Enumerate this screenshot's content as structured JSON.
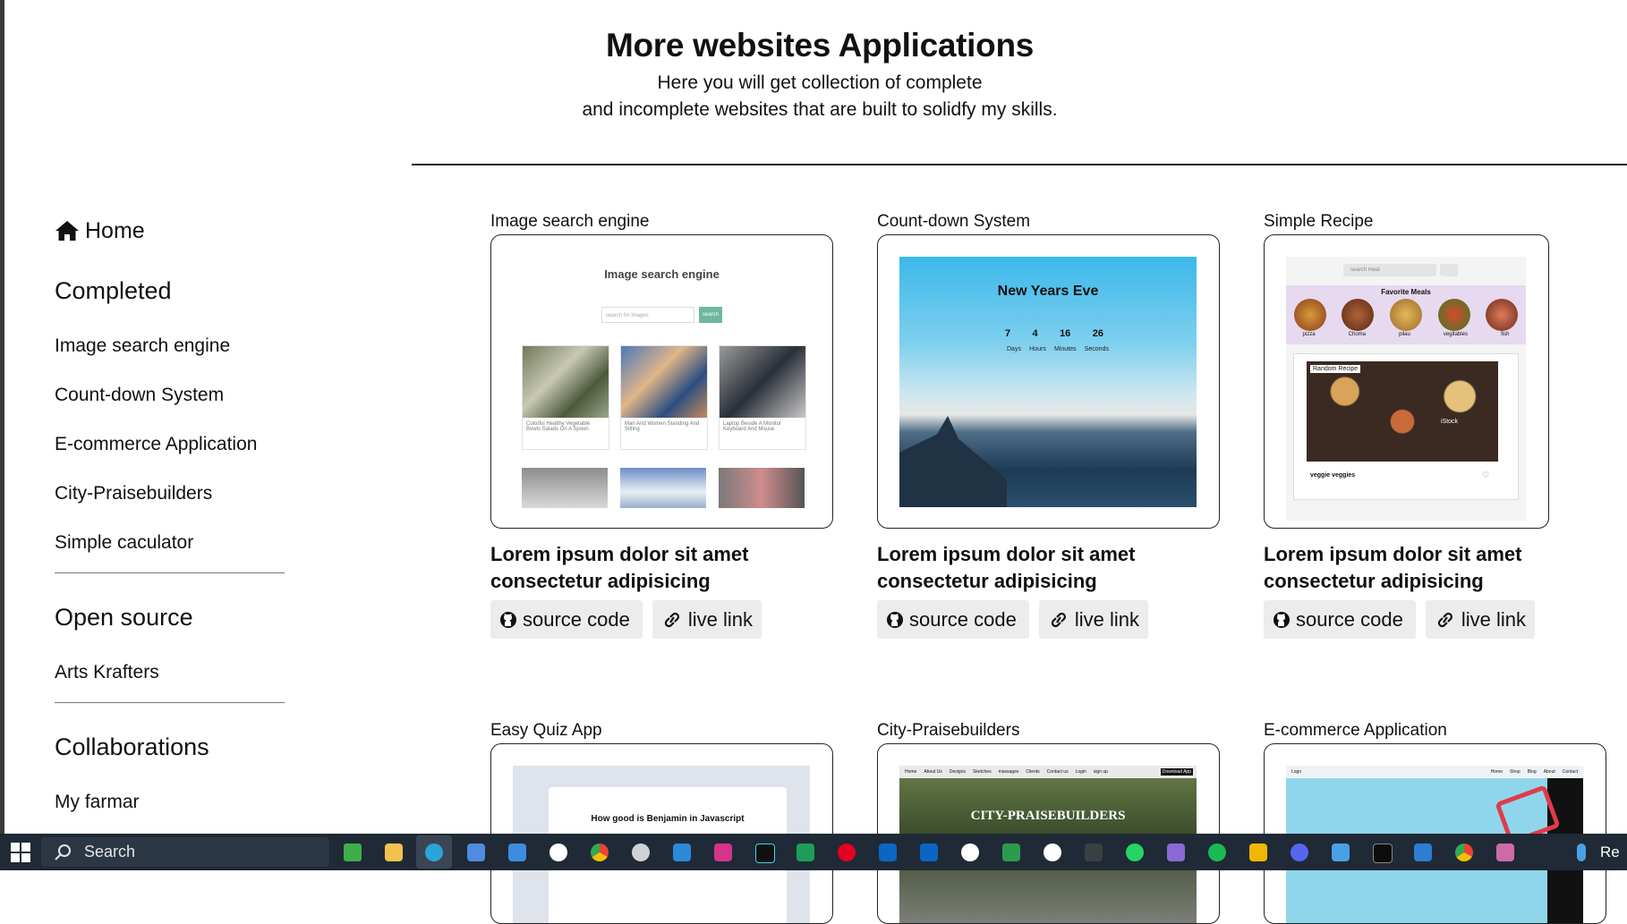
{
  "header": {
    "title": "More websites Applications",
    "line1": "Here you will get collection of complete",
    "line2": "and incomplete websites that are built to solidfy my skills."
  },
  "sidebar": {
    "home": "Home",
    "completed": "Completed",
    "completed_items": [
      "Image search engine",
      "Count-down System",
      "E-commerce Application",
      "City-Praisebuilders",
      "Simple caculator"
    ],
    "open_source": "Open source",
    "open_source_items": [
      "Arts Krafters"
    ],
    "collaborations": "Collaborations",
    "collab_items": [
      "My farmar"
    ]
  },
  "cards": [
    {
      "title": "Image search engine",
      "desc1": "Lorem ipsum dolor sit amet",
      "desc2": "consectetur adipisicing",
      "source": "source code",
      "live": "live link"
    },
    {
      "title": "Count-down System",
      "desc1": "Lorem ipsum dolor sit amet",
      "desc2": "consectetur adipisicing",
      "source": "source code",
      "live": "live link"
    },
    {
      "title": "Simple Recipe",
      "desc1": "Lorem ipsum dolor sit amet",
      "desc2": "consectetur adipisicing",
      "source": "source code",
      "live": "live link"
    },
    {
      "title": "Easy Quiz App"
    },
    {
      "title": "City-Praisebuilders"
    },
    {
      "title": "E-commerce Application"
    }
  ],
  "thumbs": {
    "image_search": {
      "heading": "Image search engine",
      "placeholder": "search for images",
      "button": "search",
      "captions": [
        "Colorful Healthy Vegetable Bowls Salads On A Spoon",
        "Man And Women Standing And Sitting",
        "Laptop Beside A Monitor Keyboard And Mouse"
      ]
    },
    "countdown": {
      "heading": "New Years Eve",
      "numbers": [
        "7",
        "4",
        "16",
        "26"
      ],
      "units": [
        "Days",
        "Hours",
        "Minutes",
        "Seconds"
      ]
    },
    "recipe": {
      "search": "search meal",
      "fav": "Favorite Meals",
      "meals": [
        "pizza",
        "Choma",
        "pilau",
        "vegitables",
        "fish"
      ],
      "random": "Random Recipe",
      "name": "veggie veggies",
      "stock": "iStock"
    },
    "quiz": {
      "question": "How good is Benjamin in Javascript"
    },
    "city": {
      "banner": "CITY-PRAISEBUILDERS",
      "menu": [
        "Home",
        "About Us",
        "Designs",
        "Sketches",
        "massages",
        "Clients",
        "Contact us",
        "Login",
        "sign up"
      ],
      "download": "Download App"
    },
    "ecom": {
      "logo": "Logo",
      "menu": [
        "Home",
        "Shop",
        "Blog",
        "About",
        "Contact"
      ]
    }
  },
  "taskbar": {
    "search": "Search",
    "right": "Re"
  },
  "colors": {
    "taskbar": "#1f2a36",
    "accent_teal": "#6fb7a0",
    "sky": "#5cc4e6"
  }
}
